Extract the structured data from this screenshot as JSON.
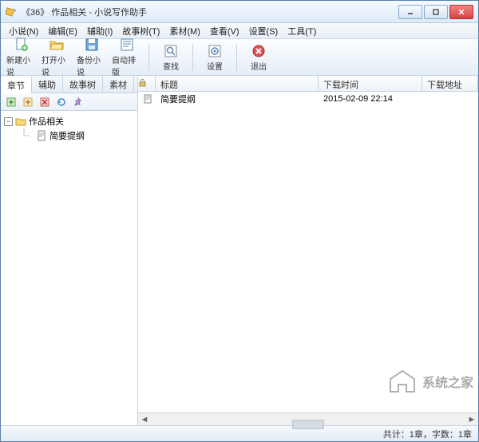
{
  "title": "《36》 作品相关 - 小说写作助手",
  "menu": {
    "novel": "小说(N)",
    "edit": "编辑(E)",
    "assist": "辅助(I)",
    "storytree": "故事树(T)",
    "material": "素材(M)",
    "view": "查看(V)",
    "settings": "设置(S)",
    "tools": "工具(T)"
  },
  "toolbar": {
    "new_novel": "新建小说",
    "open_novel": "打开小说",
    "backup_novel": "备份小说",
    "auto_typeset": "自动排版",
    "find": "查找",
    "settings": "设置",
    "exit": "退出"
  },
  "left_tabs": {
    "chapter": "章节",
    "assist": "辅助",
    "storytree": "故事树",
    "material": "素材"
  },
  "tree": {
    "root": "作品相关",
    "child1": "简要提纲"
  },
  "columns": {
    "title": "标题",
    "download_time": "下载时间",
    "download_addr": "下载地址"
  },
  "rows": [
    {
      "icon": "doc-icon",
      "title": "简要提纲",
      "time": "2015-02-09 22:14",
      "addr": ""
    }
  ],
  "status": "共计：1章，字数：1章",
  "watermark": "系统之家"
}
